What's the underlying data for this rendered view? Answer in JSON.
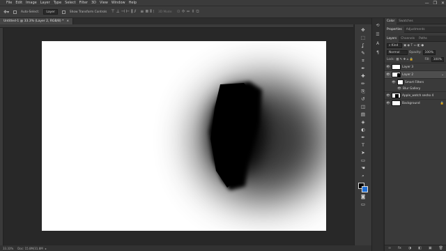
{
  "menu": [
    "File",
    "Edit",
    "Image",
    "Layer",
    "Type",
    "Select",
    "Filter",
    "3D",
    "View",
    "Window",
    "Help"
  ],
  "window_controls": [
    "—",
    "❐",
    "✕"
  ],
  "options": {
    "auto_select_label": "Auto-Select:",
    "auto_select_value": "Layer",
    "show_transform_label": "Show Transform Controls",
    "mode_label": "3D Mode:"
  },
  "doc_tab": {
    "title": "Untitled-1 @ 33.3% (Layer 2, RGB/8) *",
    "close": "×"
  },
  "status": {
    "zoom": "33.33%",
    "doc_info": "Doc: 15.8M/31.8M"
  },
  "tools": [
    "move-icon",
    "marquee-icon",
    "lasso-icon",
    "quick-select-icon",
    "crop-icon",
    "eyedropper-icon",
    "healing-icon",
    "brush-icon",
    "stamp-icon",
    "history-brush-icon",
    "eraser-icon",
    "gradient-icon",
    "blur-icon",
    "dodge-icon",
    "pen-icon",
    "type-icon",
    "path-select-icon",
    "shape-icon",
    "hand-icon",
    "zoom-icon"
  ],
  "tool_glyphs": [
    "✥",
    "⬚",
    "ʆ",
    "✎",
    "⌗",
    "✒",
    "✚",
    "✏",
    "⎘",
    "↺",
    "◫",
    "▤",
    "💧",
    "◐",
    "✒",
    "T",
    "➤",
    "▭",
    "✋",
    "🔍"
  ],
  "colors": {
    "foreground": "#000000",
    "background": "#1f6fd6"
  },
  "panel_tabs_top": [
    "Color",
    "Swatches"
  ],
  "panel_tabs_mid": [
    "Properties",
    "Adjustments"
  ],
  "panel_tabs_layers": [
    "Layers",
    "Channels",
    "Paths"
  ],
  "layers_panel": {
    "filter_kind": "Kind",
    "blend_mode": "Normal",
    "opacity_label": "Opacity:",
    "opacity_value": "100%",
    "lock_label": "Lock:",
    "fill_label": "Fill:",
    "fill_value": "100%",
    "layers": [
      {
        "name": "Layer 3",
        "visible": true,
        "selected": false
      },
      {
        "name": "Layer 2",
        "visible": true,
        "selected": true
      },
      {
        "name": "Smart Filters",
        "visible": true,
        "selected": false
      },
      {
        "name": "Blur Gallery",
        "visible": true,
        "selected": false
      },
      {
        "name": "Apple_watch sesho 4",
        "visible": true,
        "selected": false
      },
      {
        "name": "Background",
        "visible": true,
        "selected": false
      }
    ],
    "bottom_icons": [
      "∞",
      "fx",
      "◑",
      "◧",
      "▣",
      "🗑"
    ]
  }
}
